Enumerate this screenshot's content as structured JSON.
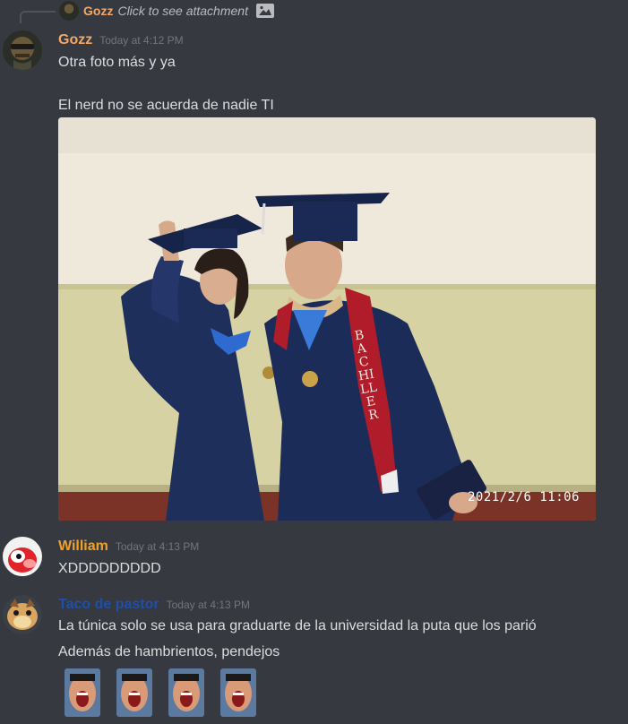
{
  "reply": {
    "username": "Gozz",
    "text": "Click to see attachment",
    "icon": "image-icon"
  },
  "messages": [
    {
      "username": "Gozz",
      "username_color": "#f2a868",
      "timestamp": "Today at 4:12 PM",
      "lines": [
        "Otra foto más y ya",
        "El nerd no se acuerda de nadie TI"
      ],
      "attachment": {
        "type": "photo",
        "stamp": "2021/2/6  11:06",
        "sash_text": "BACHILLER"
      }
    },
    {
      "username": "William",
      "username_color": "#f0a126",
      "timestamp": "Today at 4:13 PM",
      "lines": [
        "XDDDDDDDDD"
      ]
    },
    {
      "username": "Taco de pastor",
      "username_color": "#1f4fa8",
      "timestamp": "Today at 4:13 PM",
      "lines": [
        "La túnica solo se usa para graduarte de la universidad la puta que los parió",
        "Además de hambrientos, pendejos"
      ],
      "emojis": [
        "laughing-face-emoji",
        "laughing-face-emoji",
        "laughing-face-emoji",
        "laughing-face-emoji"
      ]
    }
  ]
}
